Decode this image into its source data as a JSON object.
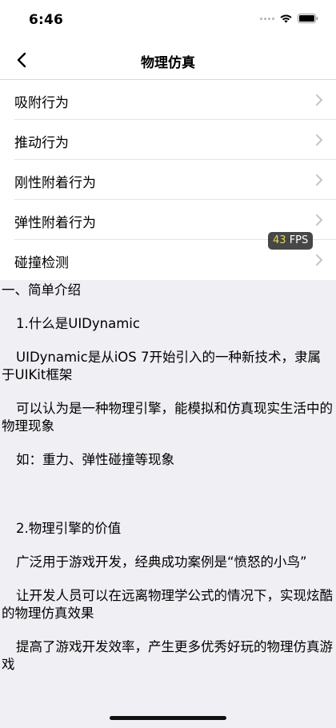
{
  "status_bar": {
    "time": "6:46"
  },
  "nav": {
    "title": "物理仿真"
  },
  "menu": {
    "items": [
      {
        "label": "吸附行为"
      },
      {
        "label": "推动行为"
      },
      {
        "label": "刚性附着行为"
      },
      {
        "label": "弹性附着行为"
      },
      {
        "label": "碰撞检测"
      }
    ]
  },
  "fps": {
    "value": "43",
    "unit": "FPS"
  },
  "content": {
    "section_title": "一、简单介绍",
    "p1": "1.什么是UIDynamic",
    "p2": "UIDynamic是从iOS 7开始引入的一种新技术，隶属于UIKit框架",
    "p3": "可以认为是一种物理引擎，能模拟和仿真现实生活中的物理现象",
    "p4": "如：重力、弹性碰撞等现象",
    "p5": "2.物理引擎的价值",
    "p6": "广泛用于游戏开发，经典成功案例是“愤怒的小鸟”",
    "p7": "让开发人员可以在远离物理学公式的情况下，实现炫酷的物理仿真效果",
    "p8": "提高了游戏开发效率，产生更多优秀好玩的物理仿真游戏"
  }
}
